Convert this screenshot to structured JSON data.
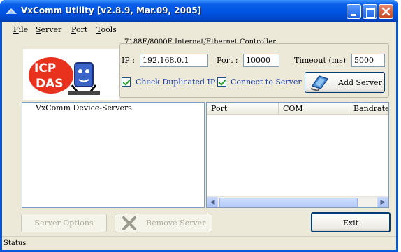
{
  "window": {
    "title": "VxComm Utility [v2.8.9, Mar.09, 2005]"
  },
  "menu": {
    "items": [
      "File",
      "Server",
      "Port",
      "Tools"
    ]
  },
  "logo": {
    "text": "ICP DAS"
  },
  "controller": {
    "group_title": "7188E/8000E Internet/Ethernet Controller",
    "ip_label": "IP :",
    "ip_value": "192.168.0.1",
    "port_label": "Port :",
    "port_value": "10000",
    "timeout_label": "Timeout (ms)",
    "timeout_value": "5000",
    "check_duplicated_label": "Check Duplicated IP",
    "check_duplicated_checked": true,
    "connect_label": "Connect to Server",
    "connect_checked": true,
    "add_server_label": "Add Server"
  },
  "servers": {
    "header": "VxComm Device-Servers"
  },
  "ports_table": {
    "columns": [
      "Port",
      "COM",
      "Bandrate"
    ]
  },
  "buttons": {
    "server_options": "Server Options",
    "remove_server": "Remove Server",
    "exit": "Exit"
  },
  "status": {
    "text": "Status"
  },
  "colors": {
    "titlebar": "#0054e3",
    "window_bg": "#ece9d8",
    "link": "#1b3fa8"
  }
}
